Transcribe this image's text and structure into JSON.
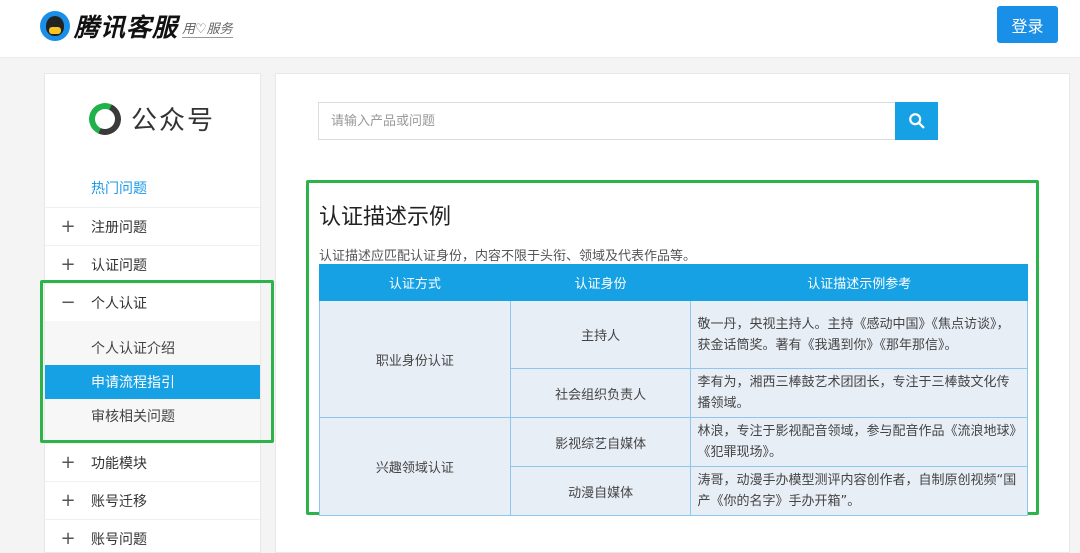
{
  "header": {
    "logo_text": "腾讯客服",
    "slogan": "用♡服务",
    "login_label": "登录"
  },
  "sidebar": {
    "brand_name": "公众号",
    "hot": "热门问题",
    "items_top": [
      {
        "label": "注册问题",
        "toggle": "+"
      },
      {
        "label": "认证问题",
        "toggle": "+"
      },
      {
        "label": "个人认证",
        "toggle": "−"
      }
    ],
    "sub_items": [
      {
        "label": "个人认证介绍"
      },
      {
        "label": "申请流程指引"
      },
      {
        "label": "审核相关问题"
      }
    ],
    "items_bottom": [
      {
        "label": "功能模块",
        "toggle": "+"
      },
      {
        "label": "账号迁移",
        "toggle": "+"
      },
      {
        "label": "账号问题",
        "toggle": "+"
      }
    ]
  },
  "search": {
    "placeholder": "请输入产品或问题"
  },
  "content": {
    "title": "认证描述示例",
    "desc": "认证描述应匹配认证身份，内容不限于头衔、领域及代表作品等。",
    "table": {
      "headers": [
        "认证方式",
        "认证身份",
        "认证描述示例参考"
      ],
      "groups": [
        {
          "method": "职业身份认证",
          "rows": [
            {
              "identity": "主持人",
              "example": "敬一丹，央视主持人。主持《感动中国》《焦点访谈》，获金话筒奖。著有《我遇到你》《那年那信》。"
            },
            {
              "identity": "社会组织负责人",
              "example": "李有为，湘西三棒鼓艺术团团长，专注于三棒鼓文化传播领域。"
            }
          ]
        },
        {
          "method": "兴趣领域认证",
          "rows": [
            {
              "identity": "影视综艺自媒体",
              "example": "林浪，专注于影视配音领域，参与配音作品《流浪地球》《犯罪现场》。"
            },
            {
              "identity": "动漫自媒体",
              "example": "涛哥，动漫手办模型测评内容创作者，自制原创视频“国产《你的名字》手办开箱”。"
            }
          ]
        }
      ]
    }
  },
  "colors": {
    "accent": "#17a1e5",
    "highlight_border": "#2db34a"
  }
}
